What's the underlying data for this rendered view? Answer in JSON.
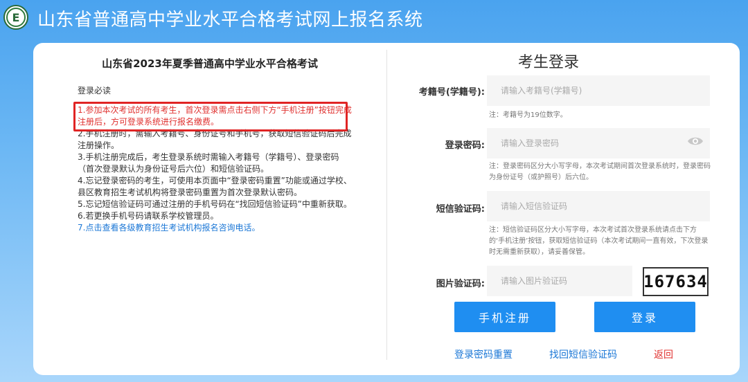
{
  "header": {
    "logo_letter": "E",
    "title": "山东省普通高中学业水平合格考试网上报名系统"
  },
  "notice": {
    "title": "山东省2023年夏季普通高中学业水平合格考试",
    "heading": "登录必读",
    "items": [
      "1.参加本次考试的所有考生，首次登录需点击右侧下方“手机注册”按钮完成注册后，方可登录系统进行报名缴费。",
      "2.手机注册时，需输入考籍号、身份证号和手机号，获取短信验证码后完成注册操作。",
      "3.手机注册完成后，考生登录系统时需输入考籍号（学籍号）、登录密码（首次登录默认为身份证号后六位）和短信验证码。",
      "4.忘记登录密码的考生，可使用本页面中“登录密码重置”功能或通过学校、县区教育招生考试机构将登录密码重置为首次登录默认密码。",
      "5.忘记短信验证码可通过注册的手机号码在“找回短信验证码”中重新获取。",
      "6.若更换手机号码请联系学校管理员。"
    ],
    "item7_prefix": "7.",
    "item7_link": "点击查看各级教育招生考试机构报名咨询电话。"
  },
  "login": {
    "title": "考生登录",
    "exam_id_label": "考籍号(学籍号):",
    "exam_id_placeholder": "请输入考籍号(学籍号)",
    "exam_id_value": "",
    "exam_id_hint": "注：考籍号为19位数字。",
    "password_label": "登录密码:",
    "password_placeholder": "请输入登录密码",
    "password_value": "",
    "password_hint": "注：登录密码区分大小写字母，本次考试期间首次登录系统时，登录密码为身份证号（或护照号）后六位。",
    "sms_label": "短信验证码:",
    "sms_placeholder": "请输入短信验证码",
    "sms_value": "",
    "sms_hint": "注：短信验证码区分大小写字母，本次考试首次登录系统请点击下方的‘手机注册’按钮，获取短信验证码（本次考试期间一直有效，下次登录时无需重新获取），请妥善保管。",
    "captcha_label": "图片验证码:",
    "captcha_placeholder": "请输入图片验证码",
    "captcha_value": "",
    "captcha_text": "167634",
    "register_button": "手机注册",
    "login_button": "登录",
    "reset_password_link": "登录密码重置",
    "recover_sms_link": "找回短信验证码",
    "back_link": "返回"
  },
  "icons": {
    "eye": "eye-icon",
    "logo": "logo-icon"
  },
  "colors": {
    "accent": "#1f8ef1",
    "warning": "#e0312f",
    "link": "#1b77d6",
    "back_link": "#e0312f"
  }
}
